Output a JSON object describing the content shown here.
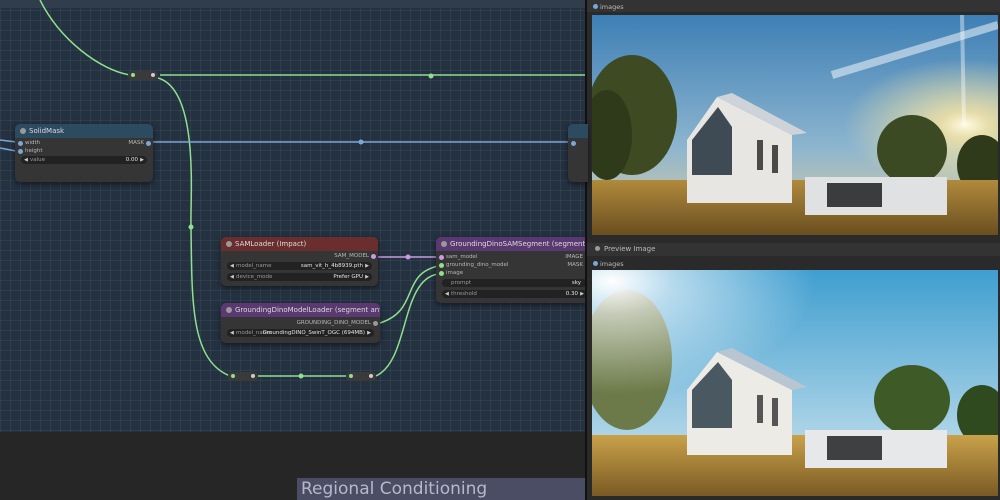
{
  "canvas": {
    "group_title": "Regional Conditioning"
  },
  "nodes": {
    "solidmask": {
      "title": "SolidMask",
      "inputs": [
        "width",
        "height"
      ],
      "output": "MASK",
      "widget": {
        "label": "value",
        "value": "0.00"
      }
    },
    "samloader": {
      "title": "SAMLoader (Impact)",
      "output": "SAM_MODEL",
      "widgets": [
        {
          "label": "model_name",
          "value": "sam_vit_h_4b8939.pth"
        },
        {
          "label": "device_mode",
          "value": "Prefer GPU"
        }
      ]
    },
    "groundingdino_loader": {
      "title": "GroundingDinoModelLoader (segment anything)",
      "output": "GROUNDING_DINO_MODEL",
      "widget": {
        "label": "model_name",
        "value": "GroundingDINO_SwinT_OGC (694MB)"
      }
    },
    "groundingdino_segment": {
      "title": "GroundingDinoSAMSegment (segment anything)",
      "inputs": [
        "sam_model",
        "grounding_dino_model",
        "image"
      ],
      "outputs": [
        "IMAGE",
        "MASK"
      ],
      "widgets": [
        {
          "label": "prompt",
          "value": "sky"
        },
        {
          "label": "threshold",
          "value": "0.30"
        }
      ]
    }
  },
  "right_panel": {
    "top_input_label": "images",
    "preview_title": "Preview Image",
    "preview_input_label": "images",
    "top_image_description": "modern house sunset",
    "bottom_image_description": "modern house daylight"
  },
  "colors": {
    "wire_green": "#8fe08f",
    "wire_blue": "#7aa7d8",
    "wire_purple": "#c89ce0",
    "title_red": "#6b2e2e",
    "title_purple": "#5a3870",
    "title_blue": "#2c4a60"
  }
}
